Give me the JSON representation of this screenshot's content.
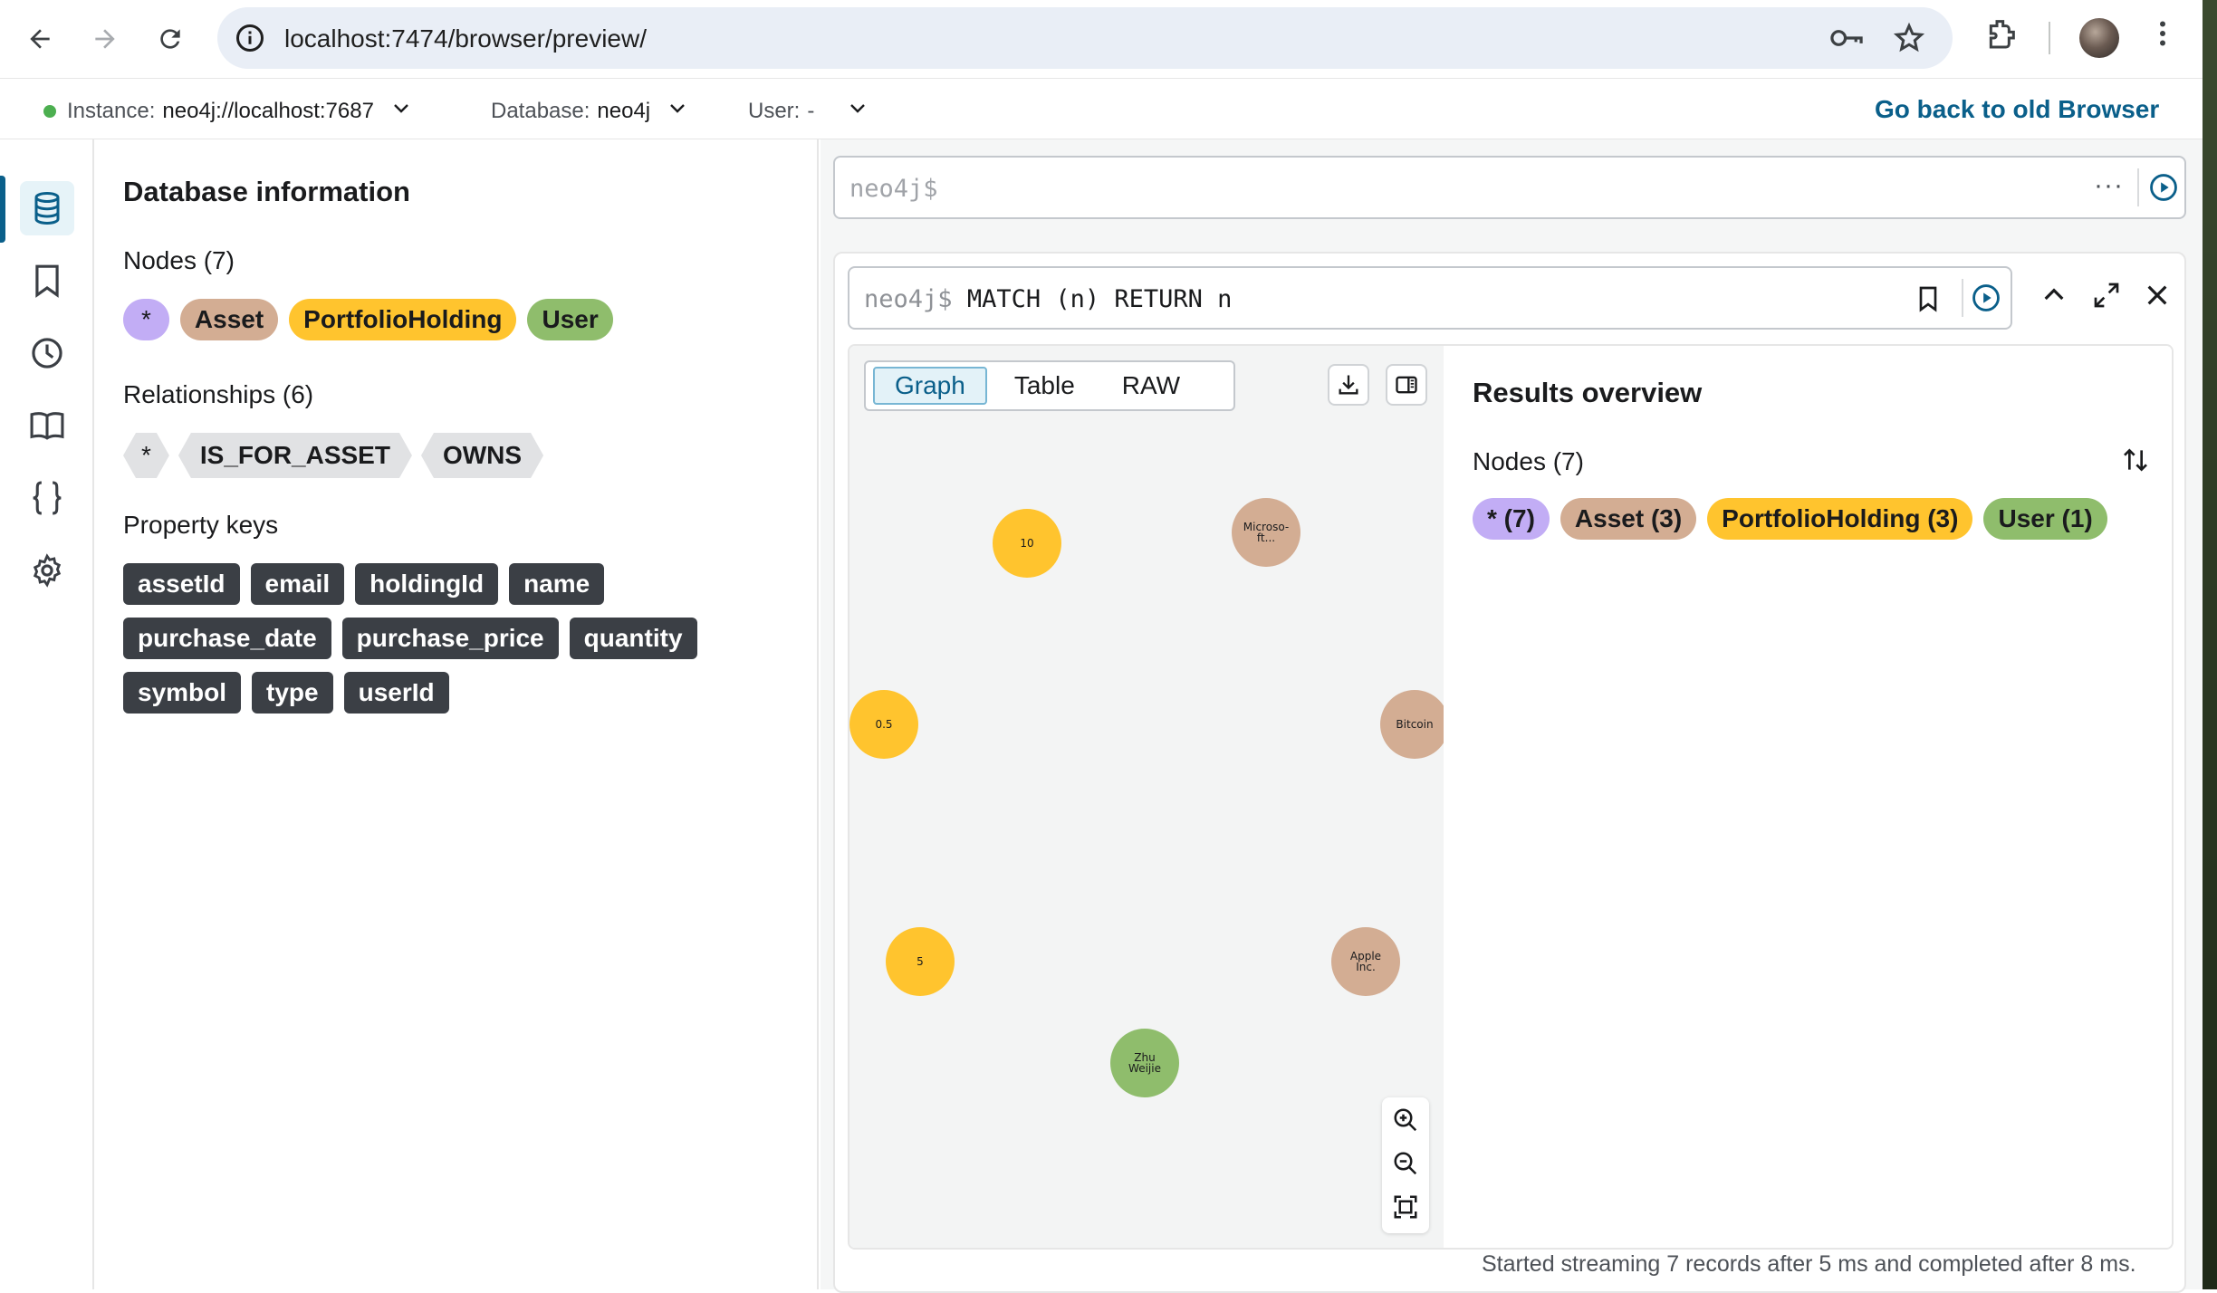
{
  "browser": {
    "url": "localhost:7474/browser/preview/"
  },
  "header": {
    "instance_label": "Instance:",
    "instance_value": "neo4j://localhost:7687",
    "database_label": "Database:",
    "database_value": "neo4j",
    "user_label": "User:",
    "user_value": "-",
    "go_back": "Go back to old Browser",
    "status_color": "#4caf50"
  },
  "sidebar": {
    "items": [
      "database-icon",
      "bookmark-icon",
      "history-icon",
      "book-icon",
      "braces-icon",
      "settings-icon"
    ]
  },
  "dbinfo": {
    "title": "Database information",
    "nodes_title": "Nodes (7)",
    "node_labels": [
      "*",
      "Asset",
      "PortfolioHolding",
      "User"
    ],
    "relationships_title": "Relationships (6)",
    "relationship_types": [
      "*",
      "IS_FOR_ASSET",
      "OWNS"
    ],
    "property_keys_title": "Property keys",
    "property_keys": [
      "assetId",
      "email",
      "holdingId",
      "name",
      "purchase_date",
      "purchase_price",
      "quantity",
      "symbol",
      "type",
      "userId"
    ]
  },
  "editor": {
    "placeholder": "neo4j$",
    "more": "···"
  },
  "frame": {
    "prompt": "neo4j$",
    "query": "MATCH (n) RETURN n",
    "tabs": [
      "Graph",
      "Table",
      "RAW"
    ],
    "nodes": [
      {
        "text": "10",
        "kind": "ph"
      },
      {
        "text": "Microso-\nft...",
        "kind": "as"
      },
      {
        "text": "0.5",
        "kind": "ph"
      },
      {
        "text": "Bitcoin",
        "kind": "as"
      },
      {
        "text": "5",
        "kind": "ph"
      },
      {
        "text": "Apple\nInc.",
        "kind": "as"
      },
      {
        "text": "Zhu\nWeijie",
        "kind": "us"
      }
    ],
    "overview_title": "Results overview",
    "overview_nodes": "Nodes (7)",
    "overview_chips": [
      "* (7)",
      "Asset (3)",
      "PortfolioHolding (3)",
      "User (1)"
    ],
    "status": "Started streaming 7 records after 5 ms and completed after 8 ms."
  },
  "colors": {
    "star": "#c2adf5",
    "asset": "#d3ad93",
    "portfolio": "#ffc42e",
    "user": "#8fbd6c",
    "accent": "#0a5f8a"
  }
}
